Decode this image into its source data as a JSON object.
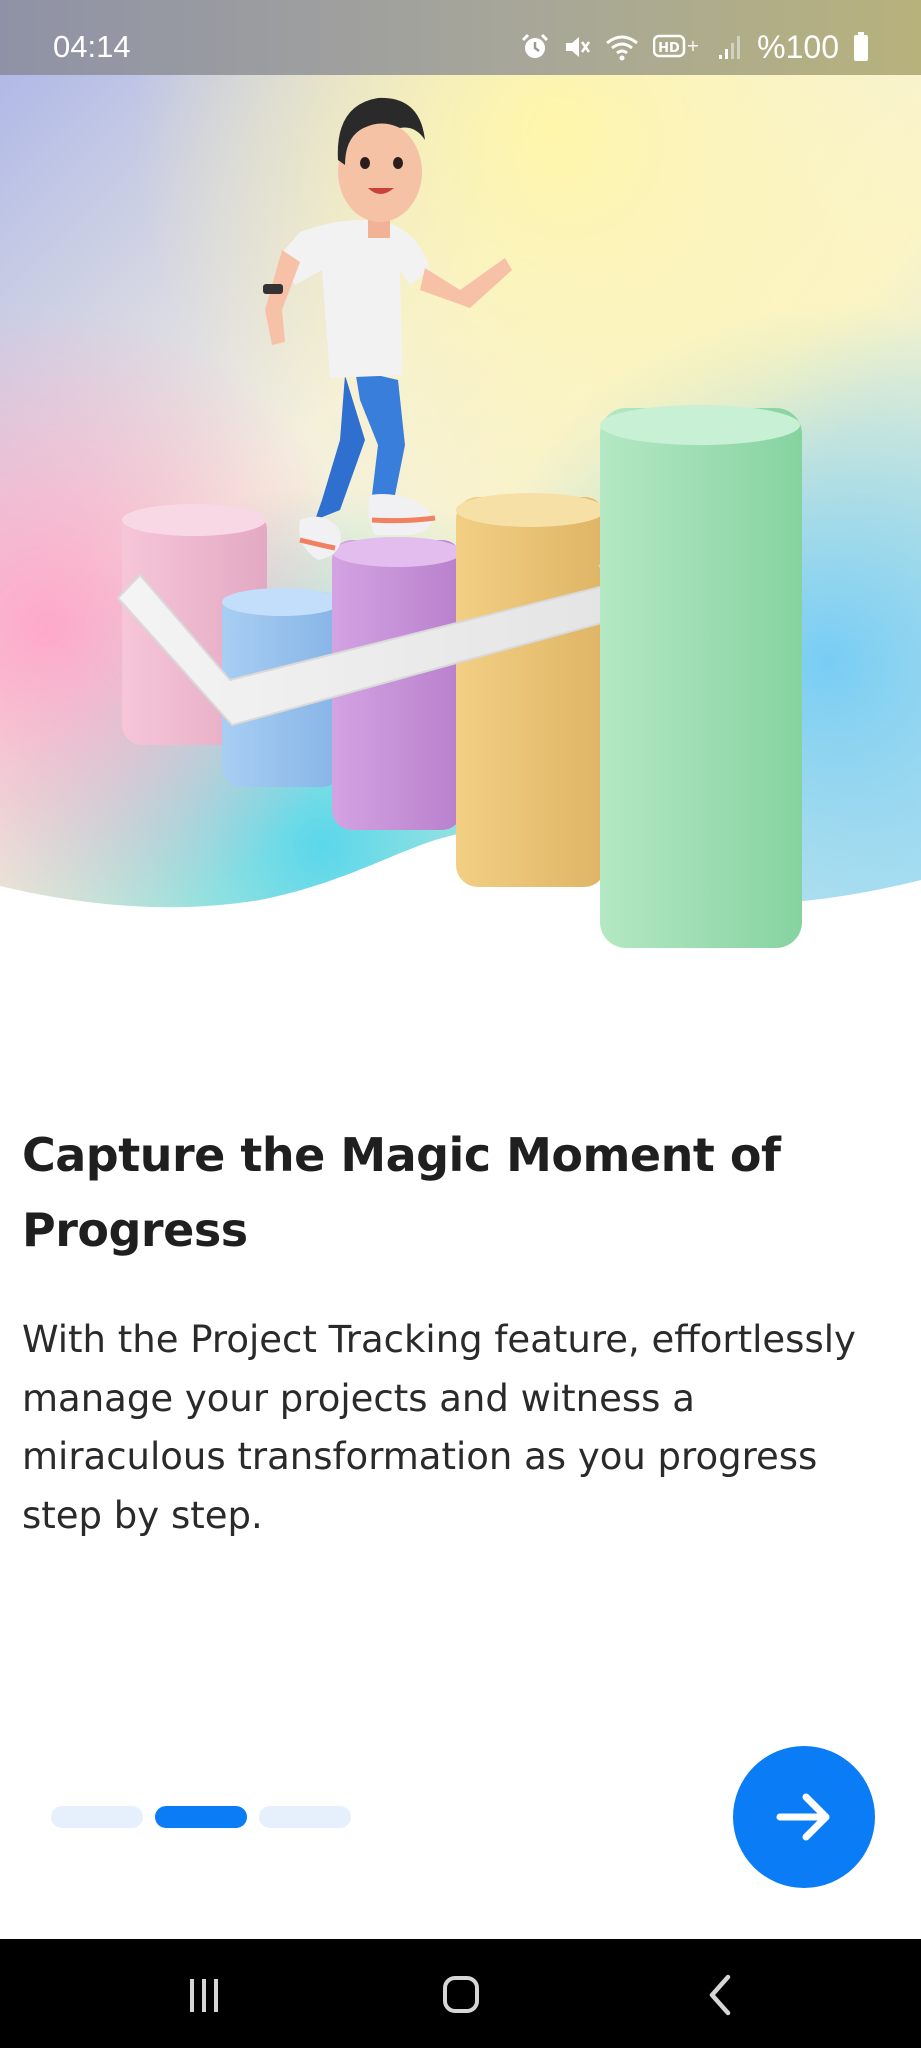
{
  "status_bar": {
    "time": "04:14",
    "battery": "%100",
    "icons": [
      "alarm-icon",
      "mute-icon",
      "wifi-icon",
      "hd-volte-icon",
      "signal-icon",
      "battery-icon"
    ]
  },
  "onboarding": {
    "title": "Capture the Magic Moment of Progress",
    "description": "With the Project Tracking feature, effortlessly manage your projects and witness a miraculous transformation as you progress step by step.",
    "pages_total": 3,
    "active_page": 2
  },
  "next_button": {
    "icon": "arrow-right-icon"
  },
  "nav_bar": {
    "icons": [
      "recents-icon",
      "home-icon",
      "back-icon"
    ]
  },
  "colors": {
    "accent": "#0a7cf5",
    "inactive_dot": "#e6f0fc",
    "title_text": "#1f1f1f",
    "body_text": "#2a2a2a"
  }
}
